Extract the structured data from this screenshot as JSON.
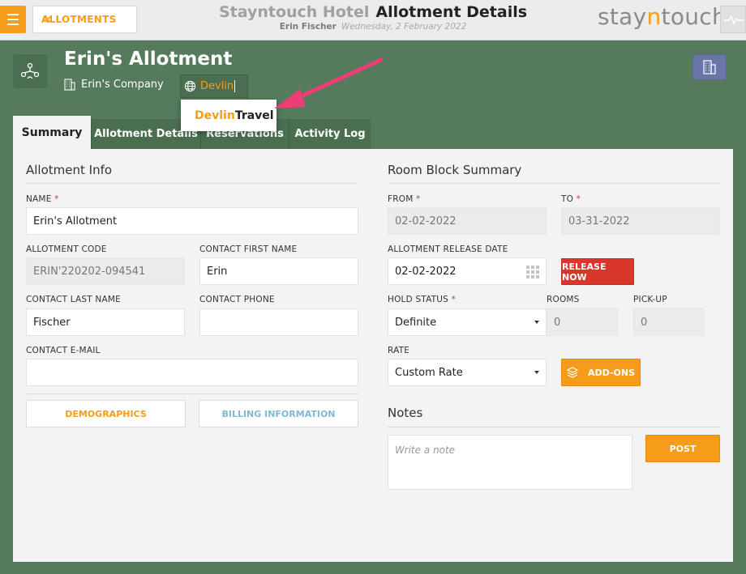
{
  "topbar": {
    "back_label": "ALLOTMENTS",
    "hotel_name": "Stayntouch Hotel",
    "page_title": "Allotment Details",
    "user_name": "Erin Fischer",
    "date": "Wednesday, 2 February 2022",
    "brand_left": "stay",
    "brand_mid": "n",
    "brand_right": "touch"
  },
  "header": {
    "title": "Erin's Allotment",
    "company": "Erin's Company",
    "travel_agent_input": "Devlin",
    "autocomplete": {
      "match": "Devlin",
      "rest": " Travel"
    }
  },
  "tabs": [
    {
      "label": "Summary",
      "active": true
    },
    {
      "label": "Allotment Details",
      "active": false
    },
    {
      "label": "Reservations",
      "active": false
    },
    {
      "label": "Activity Log",
      "active": false
    }
  ],
  "allotment_info": {
    "title": "Allotment Info",
    "name_label": "NAME",
    "name_value": "Erin's Allotment",
    "code_label": "ALLOTMENT CODE",
    "code_value": "ERIN'220202-094541",
    "first_name_label": "CONTACT FIRST NAME",
    "first_name_value": "Erin",
    "last_name_label": "CONTACT LAST NAME",
    "last_name_value": "Fischer",
    "phone_label": "CONTACT PHONE",
    "phone_value": "",
    "email_label": "CONTACT E-MAIL",
    "email_value": "",
    "demographics_label": "DEMOGRAPHICS",
    "billing_label": "BILLING INFORMATION"
  },
  "room_block": {
    "title": "Room Block Summary",
    "from_label": "FROM",
    "from_value": "02-02-2022",
    "to_label": "TO",
    "to_value": "03-31-2022",
    "release_label": "ALLOTMENT RELEASE DATE",
    "release_value": "02-02-2022",
    "release_now": "RELEASE NOW",
    "hold_status_label": "HOLD STATUS",
    "hold_status_value": "Definite",
    "rooms_label": "ROOMS",
    "rooms_value": "0",
    "pickup_label": "PICK-UP",
    "pickup_value": "0",
    "rate_label": "RATE",
    "rate_value": "Custom Rate",
    "addons_label": "ADD-ONS"
  },
  "notes": {
    "title": "Notes",
    "placeholder": "Write a note",
    "post_label": "POST"
  },
  "colors": {
    "accent": "#f59d1b",
    "background": "#557a5c",
    "danger": "#d9372c",
    "link_blue": "#7fb8d6"
  }
}
